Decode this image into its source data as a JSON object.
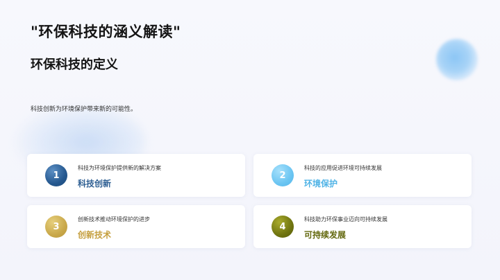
{
  "slide": {
    "title": "\"环保科技的涵义解读\"",
    "subtitle": "环保科技的定义",
    "description": "科技创新为环境保护带来新的可能性。"
  },
  "cards": [
    {
      "number": "1",
      "text": "科技为环境保护提供新的解决方案",
      "label": "科技创新",
      "color": "#2d5e92"
    },
    {
      "number": "2",
      "text": "科技的应用促进环境可持续发展",
      "label": "环境保护",
      "color": "#4fb3e6"
    },
    {
      "number": "3",
      "text": "创新技术推动环境保护的进步",
      "label": "创新技术",
      "color": "#c59f3e"
    },
    {
      "number": "4",
      "text": "科技助力环保事业迈向可持续发展",
      "label": "可持续发展",
      "color": "#64690f"
    }
  ]
}
